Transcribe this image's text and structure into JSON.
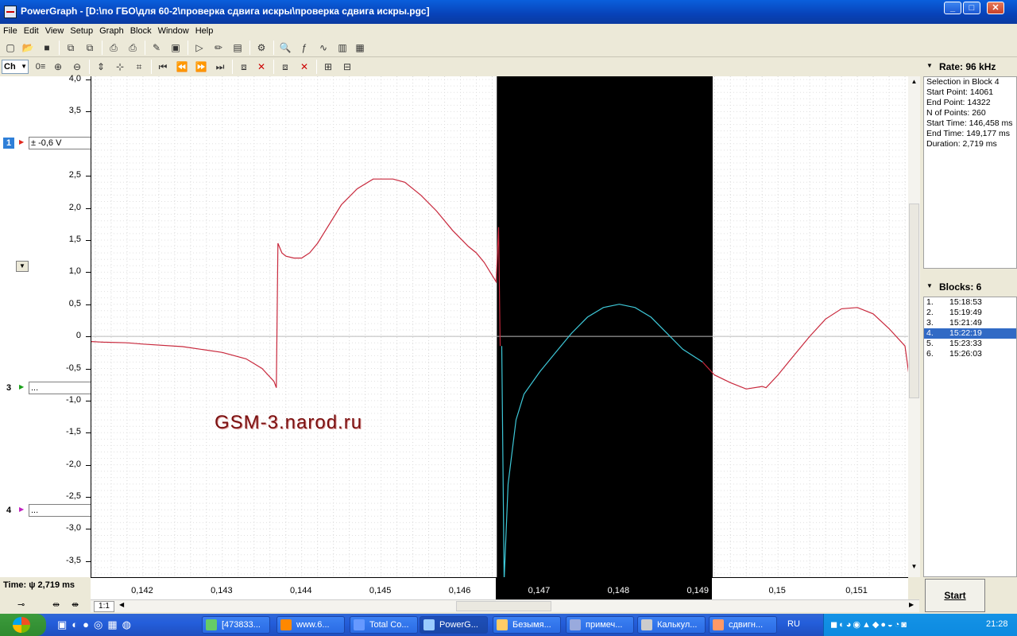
{
  "window": {
    "title": "PowerGraph - [D:\\по ГБО\\для 60-2\\проверка сдвига искры\\проверка сдвига искры.pgc]",
    "min_label": "_",
    "max_label": "□",
    "close_label": "✕"
  },
  "menu": [
    "File",
    "Edit",
    "View",
    "Setup",
    "Graph",
    "Block",
    "Window",
    "Help"
  ],
  "toolbar2": {
    "ch_label": "Ch",
    "zero_label": "0"
  },
  "channels": [
    {
      "num": "1",
      "value": "± -0,6 V",
      "color": "#e0281e",
      "numbg": "#2f7fd8",
      "numcolor": "#ffffff"
    },
    {
      "num": "3",
      "value": "...",
      "color": "#19a019",
      "numbg": "transparent",
      "numcolor": "#000000"
    },
    {
      "num": "4",
      "value": "...",
      "color": "#c020c0",
      "numbg": "transparent",
      "numcolor": "#000000"
    }
  ],
  "yaxis": {
    "ticks": [
      "4,0",
      "3,5",
      "2,5",
      "2,0",
      "1,5",
      "1,0",
      "0,5",
      "0",
      "-0,5",
      "-1,0",
      "-1,5",
      "-2,0",
      "-2,5",
      "-3,0",
      "-3,5"
    ],
    "tick_values": [
      4.0,
      3.5,
      2.5,
      2.0,
      1.5,
      1.0,
      0.5,
      0,
      -0.5,
      -1.0,
      -1.5,
      -2.0,
      -2.5,
      -3.0,
      -3.5
    ]
  },
  "xaxis": {
    "ticks": [
      "0,142",
      "0,143",
      "0,144",
      "0,145",
      "0,146",
      "0,147",
      "0,148",
      "0,149",
      "0,15",
      "0,151"
    ],
    "tick_values": [
      0.142,
      0.143,
      0.144,
      0.145,
      0.146,
      0.147,
      0.148,
      0.149,
      0.15,
      0.151
    ]
  },
  "chart_data": {
    "type": "line",
    "xlim": [
      0.14135,
      0.15165
    ],
    "ylim": [
      -3.75,
      4.05
    ],
    "selection": [
      0.146458,
      0.149177
    ],
    "watermark": "GSM-3.narod.ru",
    "series": [
      {
        "color": "#c8283c",
        "points": [
          [
            0.14135,
            -0.08
          ],
          [
            0.1415,
            -0.09
          ],
          [
            0.1418,
            -0.1
          ],
          [
            0.142,
            -0.12
          ],
          [
            0.1425,
            -0.16
          ],
          [
            0.143,
            -0.25
          ],
          [
            0.1433,
            -0.35
          ],
          [
            0.1435,
            -0.5
          ],
          [
            0.14365,
            -0.7
          ],
          [
            0.14368,
            -0.8
          ],
          [
            0.1437,
            1.45
          ],
          [
            0.14375,
            1.3
          ],
          [
            0.1438,
            1.25
          ],
          [
            0.1439,
            1.22
          ],
          [
            0.144,
            1.22
          ],
          [
            0.1441,
            1.3
          ],
          [
            0.1442,
            1.45
          ],
          [
            0.1443,
            1.65
          ],
          [
            0.1445,
            2.05
          ],
          [
            0.1447,
            2.3
          ],
          [
            0.1449,
            2.45
          ],
          [
            0.14515,
            2.45
          ],
          [
            0.1453,
            2.4
          ],
          [
            0.1455,
            2.2
          ],
          [
            0.1457,
            1.95
          ],
          [
            0.1459,
            1.65
          ],
          [
            0.1461,
            1.4
          ],
          [
            0.1462,
            1.3
          ],
          [
            0.1463,
            1.15
          ],
          [
            0.1464,
            0.95
          ],
          [
            0.14645,
            0.85
          ],
          [
            0.14648,
            1.7
          ],
          [
            0.1465,
            -0.15
          ]
        ]
      },
      {
        "color": "#3ec8d8",
        "points": [
          [
            0.14652,
            -0.15
          ],
          [
            0.14655,
            -3.8
          ],
          [
            0.1466,
            -2.3
          ],
          [
            0.1467,
            -1.3
          ],
          [
            0.1468,
            -0.9
          ],
          [
            0.147,
            -0.55
          ],
          [
            0.1472,
            -0.25
          ],
          [
            0.1474,
            0.05
          ],
          [
            0.1476,
            0.3
          ],
          [
            0.1478,
            0.45
          ],
          [
            0.148,
            0.5
          ],
          [
            0.1482,
            0.45
          ],
          [
            0.1484,
            0.3
          ],
          [
            0.1486,
            0.05
          ],
          [
            0.1488,
            -0.2
          ],
          [
            0.14905,
            -0.4
          ]
        ]
      },
      {
        "color": "#c8283c",
        "points": [
          [
            0.14905,
            -0.4
          ],
          [
            0.1492,
            -0.6
          ],
          [
            0.1494,
            -0.72
          ],
          [
            0.1496,
            -0.82
          ],
          [
            0.1498,
            -0.78
          ],
          [
            0.15,
            -0.6
          ],
          [
            0.1502,
            -0.3
          ],
          [
            0.1504,
            0.0
          ],
          [
            0.1506,
            0.27
          ],
          [
            0.1508,
            0.43
          ],
          [
            0.14985,
            -0.8
          ],
          [
            0.151,
            0.45
          ],
          [
            0.1512,
            0.35
          ],
          [
            0.1514,
            0.12
          ],
          [
            0.1516,
            -0.15
          ],
          [
            0.15165,
            -0.6
          ]
        ]
      }
    ]
  },
  "rate": {
    "label": "Rate: 96 kHz"
  },
  "selection_info": [
    "Selection in Block 4",
    "Start Point: 14061",
    "End Point: 14322",
    "N of Points: 260",
    "Start Time: 146,458 ms",
    "End Time: 149,177 ms",
    "Duration: 2,719 ms"
  ],
  "blocks": {
    "label": "Blocks: 6",
    "items": [
      {
        "n": "1.",
        "t": "15:18:53"
      },
      {
        "n": "2.",
        "t": "15:19:49"
      },
      {
        "n": "3.",
        "t": "15:21:49"
      },
      {
        "n": "4.",
        "t": "15:22:19"
      },
      {
        "n": "5.",
        "t": "15:23:33"
      },
      {
        "n": "6.",
        "t": "15:26:03"
      }
    ],
    "selected_index": 3
  },
  "bottom": {
    "time_label": "Time: ψ 2,719 ms",
    "scale_label": "1:1",
    "start_button": "Start"
  },
  "taskbar": {
    "tasks": [
      "[473833...",
      "www.6...",
      "Total Co...",
      "PowerG...",
      "Безымя...",
      "примеч...",
      "Калькул...",
      "сдвигн..."
    ],
    "lang": "RU",
    "clock": "21:28"
  }
}
